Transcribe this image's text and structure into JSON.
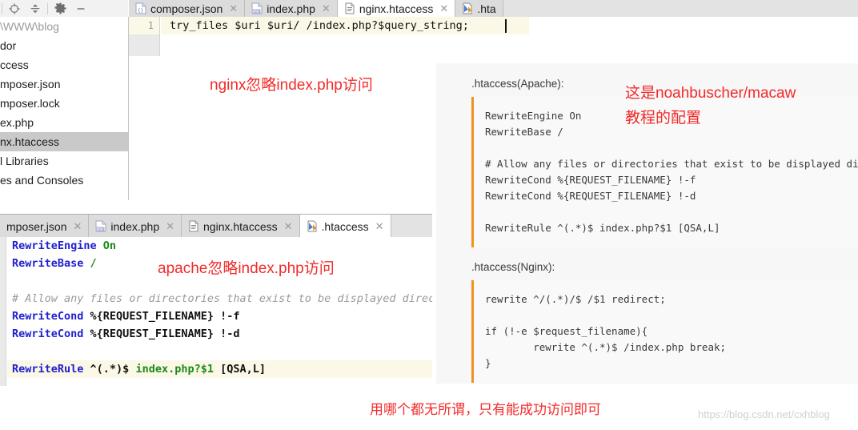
{
  "toolbar": {
    "icons": [
      {
        "name": "locate-target-icon",
        "glyph": "target"
      },
      {
        "name": "collapse-all-icon",
        "glyph": "collapse"
      },
      {
        "name": "settings-gear-icon",
        "glyph": "gear"
      },
      {
        "name": "minimize-icon",
        "glyph": "minus"
      }
    ]
  },
  "sidebar": {
    "items": [
      {
        "label": "\\WWW\\blog",
        "state": "dim"
      },
      {
        "label": "dor",
        "state": "normal"
      },
      {
        "label": "ccess",
        "state": "normal"
      },
      {
        "label": "mposer.json",
        "state": "normal"
      },
      {
        "label": "mposer.lock",
        "state": "normal"
      },
      {
        "label": "ex.php",
        "state": "normal"
      },
      {
        "label": "nx.htaccess",
        "state": "selected"
      },
      {
        "label": "l Libraries",
        "state": "normal"
      },
      {
        "label": "es and Consoles",
        "state": "normal"
      }
    ]
  },
  "top_tabs": [
    {
      "label": "composer.json",
      "icon": "json-file-icon",
      "active": false,
      "closable": true
    },
    {
      "label": "index.php",
      "icon": "php-file-icon",
      "active": false,
      "closable": true
    },
    {
      "label": "nginx.htaccess",
      "icon": "text-file-icon",
      "active": true,
      "closable": true
    },
    {
      "label": ".hta",
      "icon": "htaccess-file-icon",
      "active": false,
      "closable": false
    }
  ],
  "bottom_tabs": [
    {
      "label": "mposer.json",
      "icon": "json-file-icon",
      "active": false,
      "closable": true
    },
    {
      "label": "index.php",
      "icon": "php-file-icon",
      "active": false,
      "closable": true
    },
    {
      "label": "nginx.htaccess",
      "icon": "text-file-icon",
      "active": false,
      "closable": true
    },
    {
      "label": ".htaccess",
      "icon": "htaccess-file-icon",
      "active": true,
      "closable": true
    }
  ],
  "top_editor": {
    "line_number": "1",
    "code": "try_files $uri $uri/ /index.php?$query_string;"
  },
  "bottom_editor": {
    "lines": [
      [
        {
          "t": "dir",
          "s": "RewriteEngine "
        },
        {
          "t": "val",
          "s": "On"
        }
      ],
      [
        {
          "t": "dir",
          "s": "RewriteBase "
        },
        {
          "t": "val",
          "s": "/"
        }
      ],
      [],
      [
        {
          "t": "com",
          "s": "# Allow any files or directories that exist to be displayed direc"
        }
      ],
      [
        {
          "t": "dir",
          "s": "RewriteCond "
        },
        {
          "t": "plain",
          "s": "%{REQUEST_FILENAME} !-f"
        }
      ],
      [
        {
          "t": "dir",
          "s": "RewriteCond "
        },
        {
          "t": "plain",
          "s": "%{REQUEST_FILENAME} !-d"
        }
      ],
      [],
      [
        {
          "t": "dir",
          "s": "RewriteRule "
        },
        {
          "t": "plain",
          "s": "^(.*)$ "
        },
        {
          "t": "val",
          "s": "index.php?$1"
        },
        {
          "t": "plain",
          "s": " [QSA,L]"
        }
      ]
    ],
    "highlighted_line_index": 7
  },
  "annotations": {
    "nginx": "nginx忽略index.php访问",
    "apache": "apache忽略index.php访问",
    "right_line1": "这是noahbuscher/macaw",
    "right_line2": "教程的配置",
    "bottom": "用哪个都无所谓，只有能成功访问即可"
  },
  "right_panel": {
    "apache_label": ".htaccess(Apache):",
    "apache_code": "RewriteEngine On\nRewriteBase /\n\n# Allow any files or directories that exist to be displayed directly\nRewriteCond %{REQUEST_FILENAME} !-f\nRewriteCond %{REQUEST_FILENAME} !-d\n\nRewriteRule ^(.*)$ index.php?$1 [QSA,L]",
    "nginx_label": ".htaccess(Nginx):",
    "nginx_code": "rewrite ^/(.*)/$ /$1 redirect;\n\nif (!-e $request_filename){\n        rewrite ^(.*)$ /index.php break;\n}"
  },
  "watermark": "https://blog.csdn.net/cxhblog",
  "colors": {
    "annotation_red": "#f22b2b",
    "code_accent_orange": "#f0921e",
    "directive_blue": "#2020cf",
    "value_green": "#1a8a1a",
    "current_line_yellow": "#fbf8e7",
    "selection_gray": "#c9c9c9"
  }
}
